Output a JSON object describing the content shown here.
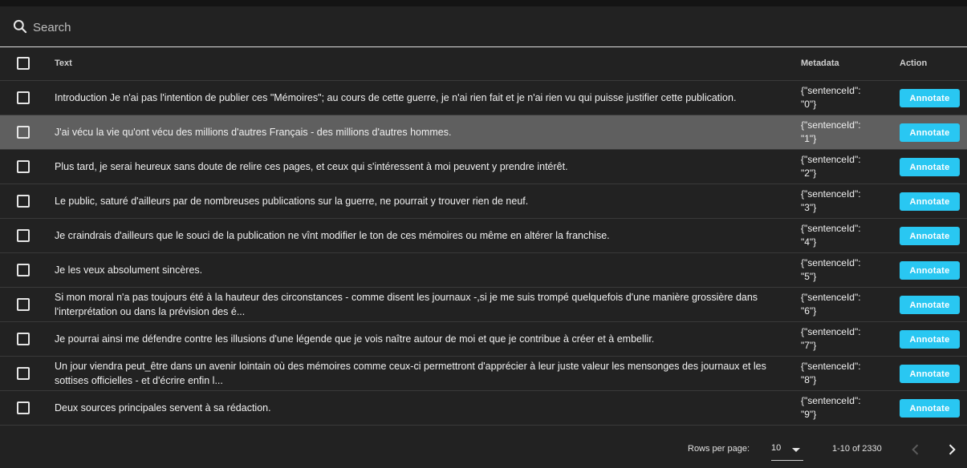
{
  "search": {
    "placeholder": "Search",
    "value": ""
  },
  "table": {
    "columns": {
      "text": "Text",
      "metadata": "Metadata",
      "action": "Action"
    },
    "rows": [
      {
        "text": "Introduction Je n'ai pas l'intention de publier ces \"Mémoires\"; au cours de cette guerre, je n'ai rien fait et je n'ai rien vu qui puisse justifier cette publication.",
        "meta1": "{\"sentenceId\":",
        "meta2": "\"0\"}",
        "action": "Annotate",
        "highlighted": false
      },
      {
        "text": "J'ai vécu la vie qu'ont vécu des millions d'autres Français - des millions d'autres hommes.",
        "meta1": "{\"sentenceId\":",
        "meta2": "\"1\"}",
        "action": "Annotate",
        "highlighted": true
      },
      {
        "text": "Plus tard, je serai heureux sans doute de relire ces pages, et ceux qui s'intéressent à moi peuvent y prendre intérêt.",
        "meta1": "{\"sentenceId\":",
        "meta2": "\"2\"}",
        "action": "Annotate",
        "highlighted": false
      },
      {
        "text": "Le public, saturé d'ailleurs par de nombreuses publications sur la guerre, ne pourrait y trouver rien de neuf.",
        "meta1": "{\"sentenceId\":",
        "meta2": "\"3\"}",
        "action": "Annotate",
        "highlighted": false
      },
      {
        "text": "Je craindrais d'ailleurs que le souci de la publication ne vînt modifier le ton de ces mémoires ou même en altérer la franchise.",
        "meta1": "{\"sentenceId\":",
        "meta2": "\"4\"}",
        "action": "Annotate",
        "highlighted": false
      },
      {
        "text": "Je les veux absolument sincères.",
        "meta1": "{\"sentenceId\":",
        "meta2": "\"5\"}",
        "action": "Annotate",
        "highlighted": false
      },
      {
        "text": "Si mon moral n'a pas toujours été à la hauteur des circonstances - comme disent les journaux -,si je me suis trompé quelquefois d'une manière grossière dans l'interprétation ou dans la prévision des é...",
        "meta1": "{\"sentenceId\":",
        "meta2": "\"6\"}",
        "action": "Annotate",
        "highlighted": false
      },
      {
        "text": "Je pourrai ainsi me défendre contre les illusions d'une légende que je vois naître autour de moi et que je contribue à créer et à embellir.",
        "meta1": "{\"sentenceId\":",
        "meta2": "\"7\"}",
        "action": "Annotate",
        "highlighted": false
      },
      {
        "text": "Un jour viendra peut_être dans un avenir lointain où des mémoires comme ceux-ci permettront d'apprécier à leur juste valeur les mensonges des journaux et les sottises officielles - et d'écrire enfin l...",
        "meta1": "{\"sentenceId\":",
        "meta2": "\"8\"}",
        "action": "Annotate",
        "highlighted": false
      },
      {
        "text": "Deux sources principales servent à sa rédaction.",
        "meta1": "{\"sentenceId\":",
        "meta2": "\"9\"}",
        "action": "Annotate",
        "highlighted": false
      }
    ]
  },
  "pagination": {
    "rows_per_page_label": "Rows per page:",
    "rows_per_page": "10",
    "range": "1-10 of 2330"
  },
  "icons": {
    "search": "search-icon",
    "dropdown": "arrow-drop-down-icon",
    "prev": "chevron-left-icon",
    "next": "chevron-right-icon"
  },
  "colors": {
    "accent": "#29c7f2",
    "background": "#222222",
    "row_highlight": "#5f5f5f"
  }
}
